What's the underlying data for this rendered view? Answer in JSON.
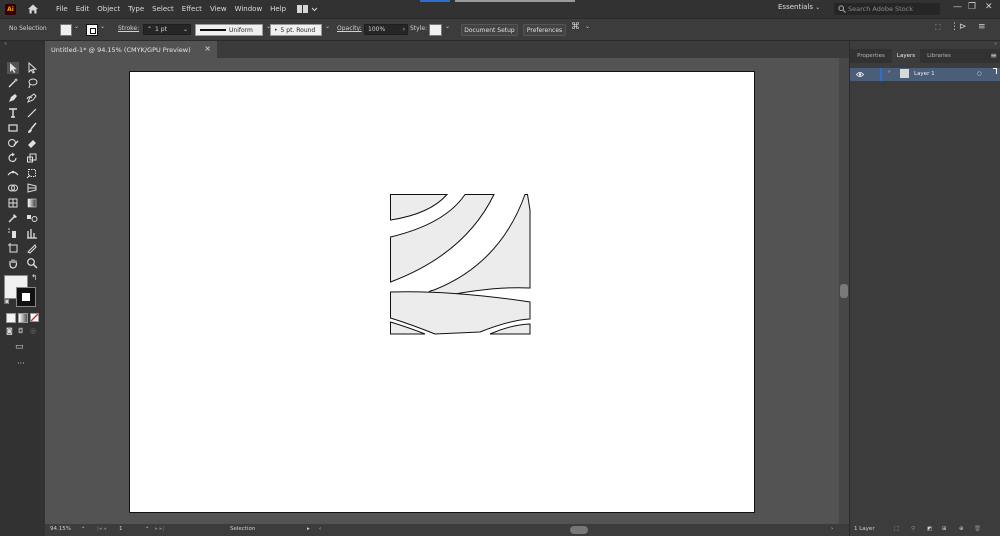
{
  "app": {
    "logo": "Ai"
  },
  "menu": {
    "items": [
      "File",
      "Edit",
      "Object",
      "Type",
      "Select",
      "Effect",
      "View",
      "Window",
      "Help"
    ],
    "workspace": "Essentials",
    "search_placeholder": "Search Adobe Stock"
  },
  "control_bar": {
    "selection_status": "No Selection",
    "stroke_label": "Stroke:",
    "stroke_weight": "1 pt",
    "stroke_profile": "Uniform",
    "brush": "5 pt. Round",
    "opacity_label": "Opacity:",
    "opacity_value": "100%",
    "style_label": "Style:",
    "document_setup": "Document Setup",
    "preferences": "Preferences"
  },
  "document": {
    "tab_title": "Untitled-1* @ 94.15% (CMYK/GPU Preview)"
  },
  "status_bar": {
    "zoom": "94.15%",
    "artboard_number": "1",
    "tool_name": "Selection"
  },
  "panels": {
    "tabs": [
      "Properties",
      "Layers",
      "Libraries"
    ],
    "active_tab": "Layers",
    "layers": [
      {
        "name": "Layer 1"
      }
    ],
    "footer_count": "1 Layer"
  },
  "colors": {
    "accent": "#2d6fd0",
    "layer_highlight": "#4a5e7a",
    "artwork_fill": "#ececec",
    "fill_swatch": "#f0f0f0"
  },
  "icons": [
    "home-icon",
    "selection-tool-icon",
    "direct-selection-tool-icon",
    "magic-wand-icon",
    "lasso-icon",
    "pen-icon",
    "curvature-icon",
    "type-icon",
    "line-icon",
    "rectangle-icon",
    "paintbrush-icon",
    "shaper-icon",
    "eraser-icon",
    "rotate-icon",
    "scale-icon",
    "width-icon",
    "free-transform-icon",
    "shape-builder-icon",
    "perspective-grid-icon",
    "mesh-icon",
    "gradient-icon",
    "eyedropper-icon",
    "blend-icon",
    "symbol-sprayer-icon",
    "column-graph-icon",
    "artboard-icon",
    "slice-icon",
    "hand-icon",
    "zoom-icon",
    "eye-icon",
    "search-icon"
  ]
}
